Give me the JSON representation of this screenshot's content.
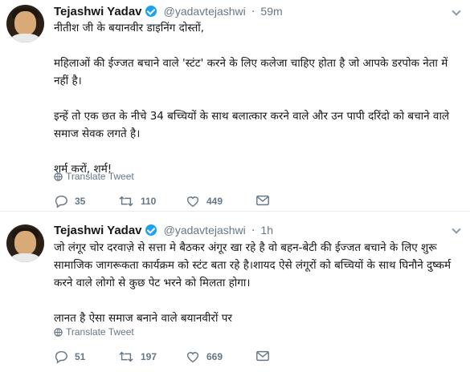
{
  "tweets": [
    {
      "name": "Tejashwi Yadav",
      "handle": "@yadavtejashwi",
      "separator": "·",
      "time": "59m",
      "text": "नीतीश जी के बयानवीर डाइनिंग दोस्तों,\n\nमहिलाओं की ईज्जत बचाने वाले 'स्टंट' करने के लिए कलेजा चाहिए होता है जो आपके डरपोक नेता में नहीं है।\n\nइन्हें तो एक छत के नीचे 34 बच्चियों के साथ बलात्कार करने वाले और उन पापी दरिंदो को बचाने वाले समाज सेवक लगते है।\n\nशर्म करों, शर्म!",
      "translate_label": "Translate Tweet",
      "replies": "35",
      "retweets": "110",
      "likes": "449"
    },
    {
      "name": "Tejashwi Yadav",
      "handle": "@yadavtejashwi",
      "separator": "·",
      "time": "1h",
      "text": "जो लंगूर चोर दरवाज़े से सत्ता मे बैठकर अंगूर खा रहे है वो बहन-बेटी की ईज्जत बचाने के लिए शुरू सामाजिक जागरूकता कार्यक्रम को स्टंट बता रहे है।शायद ऐसे लंगूरों को बच्चियों के साथ घिनौने दुष्कर्म करने वाले लोगो से कुछ पेट भरने को मिलता होगा।\n\nलानत है ऐसा समाज बनाने वाले बयानवीरों पर",
      "translate_label": "Translate Tweet",
      "replies": "51",
      "retweets": "197",
      "likes": "669"
    }
  ],
  "icons": {
    "verified": "verified-badge-icon",
    "caret": "chevron-down-icon",
    "globe": "globe-icon",
    "reply": "reply-icon",
    "retweet": "retweet-icon",
    "like": "heart-icon",
    "dm": "envelope-icon"
  },
  "colors": {
    "verified": "#1da1f2",
    "secondary_text": "#657786",
    "divider": "#e6ecf0"
  }
}
